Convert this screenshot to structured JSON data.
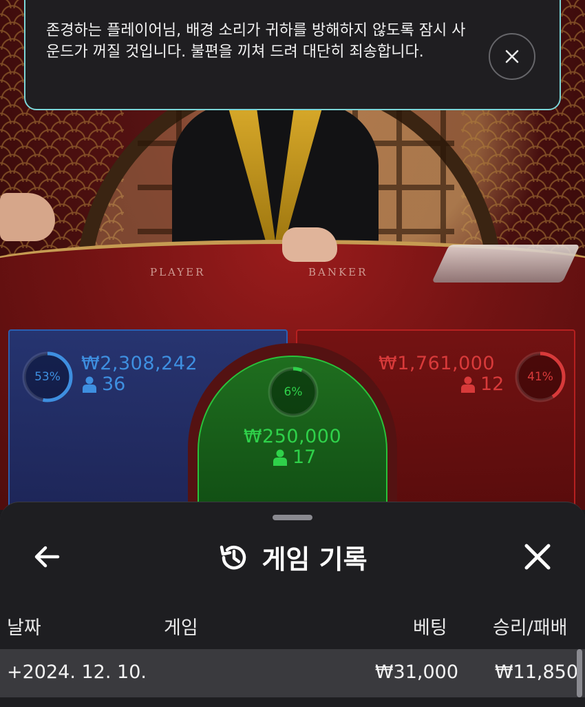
{
  "notice": {
    "message": "존경하는 플레이어님, 배경 소리가 귀하를 방해하지 않도록 잠시 사운드가 꺼질 것입니다. 불편을 끼쳐 드려 대단히 죄송합니다."
  },
  "table": {
    "player_label": "PLAYER",
    "banker_label": "BANKER"
  },
  "bets": {
    "player": {
      "percent": "53%",
      "percent_value": 0.53,
      "amount": "₩2,308,242",
      "players": "36",
      "color": "#3e8fe0"
    },
    "tie": {
      "percent": "6%",
      "percent_value": 0.06,
      "amount": "₩250,000",
      "players": "17",
      "color": "#2fd14a"
    },
    "banker": {
      "percent": "41%",
      "percent_value": 0.41,
      "amount": "₩1,761,000",
      "players": "12",
      "color": "#d83a3a"
    }
  },
  "history": {
    "title": "게임 기록",
    "columns": {
      "date": "날짜",
      "game": "게임",
      "bet": "베팅",
      "winloss": "승리/패배"
    },
    "rows": [
      {
        "date": "+2024. 12. 10.",
        "game": "",
        "bet": "₩31,000",
        "winloss": "₩11,850"
      }
    ]
  }
}
